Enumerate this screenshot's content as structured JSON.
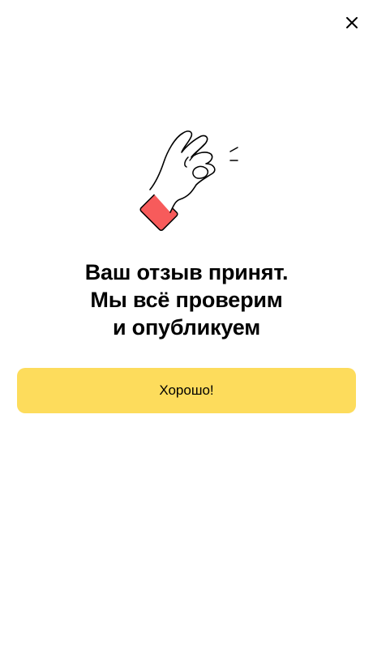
{
  "dialog": {
    "title_lines": [
      "Ваш отзыв принят.",
      "Мы всё проверим",
      "и опубликуем"
    ],
    "ok_label": "Хорошо!"
  },
  "icons": {
    "close": "close-icon",
    "illustration": "ok-hand-gesture-icon"
  },
  "colors": {
    "button_bg": "#fddc5c",
    "cuff": "#f75b5b",
    "text": "#000000"
  }
}
